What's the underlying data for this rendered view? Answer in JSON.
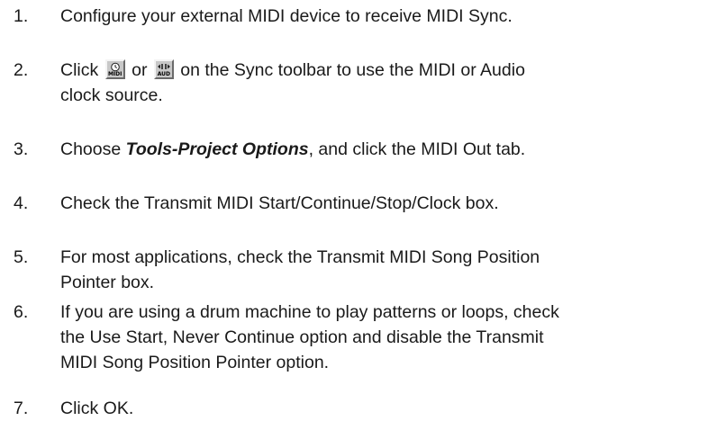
{
  "steps": [
    {
      "num": "1.",
      "text": "Configure your external MIDI device to receive MIDI Sync."
    },
    {
      "num": "2.",
      "pre": "Click",
      "mid": "or",
      "post": "on the Sync toolbar to use the MIDI or Audio",
      "line2": "clock source.",
      "midi_button_caption": "MIDI",
      "audio_button_caption": "AUD"
    },
    {
      "num": "3.",
      "pre": "Choose",
      "emph": "Tools-Project Options",
      "post": ", and click the MIDI Out tab."
    },
    {
      "num": "4.",
      "text": "Check the Transmit MIDI Start/Continue/Stop/Clock box."
    },
    {
      "num": "5.",
      "line1": "For most applications, check the Transmit MIDI Song Position",
      "line2": "Pointer box."
    },
    {
      "num": "6.",
      "line1": "If you are using a drum machine to play patterns or loops, check",
      "line2": "the Use Start, Never Continue option and disable the Transmit",
      "line3": "MIDI Song Position Pointer option."
    },
    {
      "num": "7.",
      "text": "Click OK."
    }
  ]
}
